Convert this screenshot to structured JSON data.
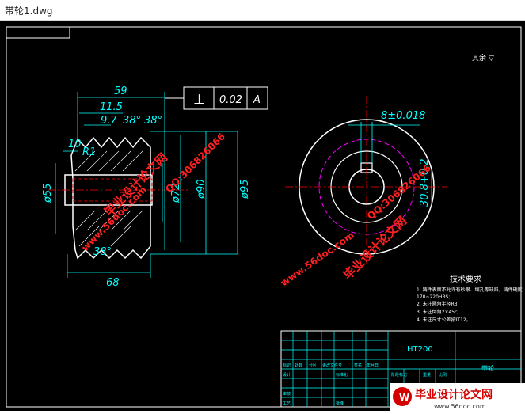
{
  "window": {
    "title": "带轮1.dwg"
  },
  "drawing": {
    "dims": {
      "d59": "59",
      "d11_5": "11.5",
      "d9_7": "9.7",
      "ang1": "38°",
      "ang2": "38°",
      "ang3": "38°",
      "d10": "10",
      "r1": "R1",
      "d55": "ø55",
      "d72": "ø72",
      "d90": "ø90",
      "d95": "ø95",
      "d68": "68",
      "d8": "8±0.018",
      "d30": "30.8+0.2",
      "d30_tol": "0"
    },
    "gdt": {
      "symbol": "⊥",
      "value": "0.02",
      "datum": "A"
    },
    "roughness": "其余 ▽",
    "tech_requirements": {
      "title": "技术要求",
      "lines": [
        "1. 铸件表面不允许有砂眼、缩孔等缺陷，铸件硬度",
        "   170~220HBS;",
        "2. 未注圆角半径R3;",
        "3. 未注倒角2×45°;",
        "4. 未注尺寸公差按IT12。"
      ]
    },
    "title_block": {
      "material": "HT200",
      "part_name": "带轮",
      "labels": [
        "标记",
        "处数",
        "分区",
        "更改文件号",
        "签名",
        "年月日",
        "设计",
        "标准化",
        "阶段标记",
        "重量",
        "比例",
        "审核",
        "工艺",
        "批准"
      ]
    }
  },
  "watermarks": {
    "brand": "毕业设计论文网",
    "site": "www.56doc.com",
    "qq": "QQ:306826066",
    "footer_brand": "毕业设计论文网",
    "footer_site": "www.56doc.com"
  },
  "colors": {
    "outline": "#ffffff",
    "dim": "#00ffff",
    "center": "#ff0000",
    "hidden": "#ff00ff",
    "watermark": "#ff2020",
    "footer_bg": "#d40000"
  }
}
